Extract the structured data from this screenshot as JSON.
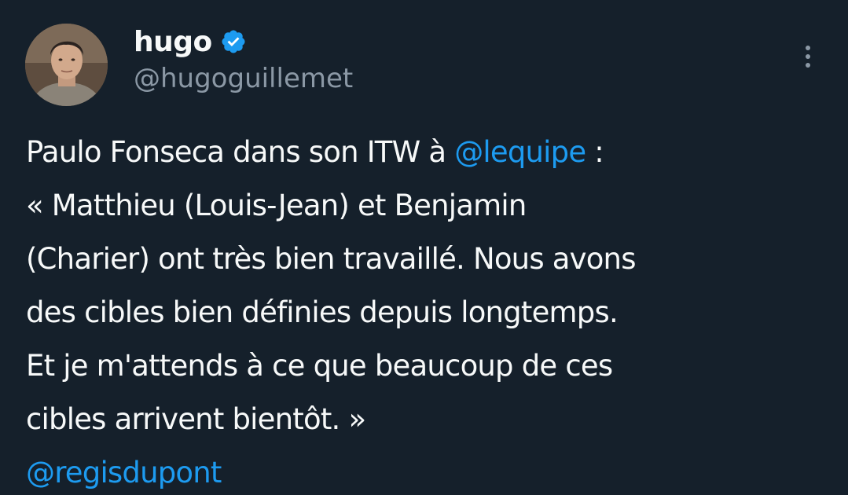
{
  "author": {
    "display_name": "hugo",
    "handle": "@hugoguillemet",
    "verified": true,
    "verified_badge_color": "#1d9bf0"
  },
  "tweet": {
    "line1_prefix": "Paulo Fonseca dans son ITW à ",
    "line1_mention": "@lequipe",
    "line1_suffix": " :",
    "line2": "« Matthieu (Louis-Jean) et Benjamin",
    "line3": "(Charier) ont très bien travaillé. Nous avons",
    "line4": "des cibles bien définies depuis longtemps.",
    "line5": "Et je m'attends à ce que beaucoup de ces",
    "line6": "cibles arrivent bientôt. »",
    "line7_mention": "@regisdupont"
  },
  "icons": {
    "more": "more-vertical-icon",
    "verified": "verified-badge-icon"
  },
  "colors": {
    "background": "#15202b",
    "text": "#f7f9f9",
    "secondary_text": "#8b98a5",
    "link": "#1d9bf0"
  }
}
